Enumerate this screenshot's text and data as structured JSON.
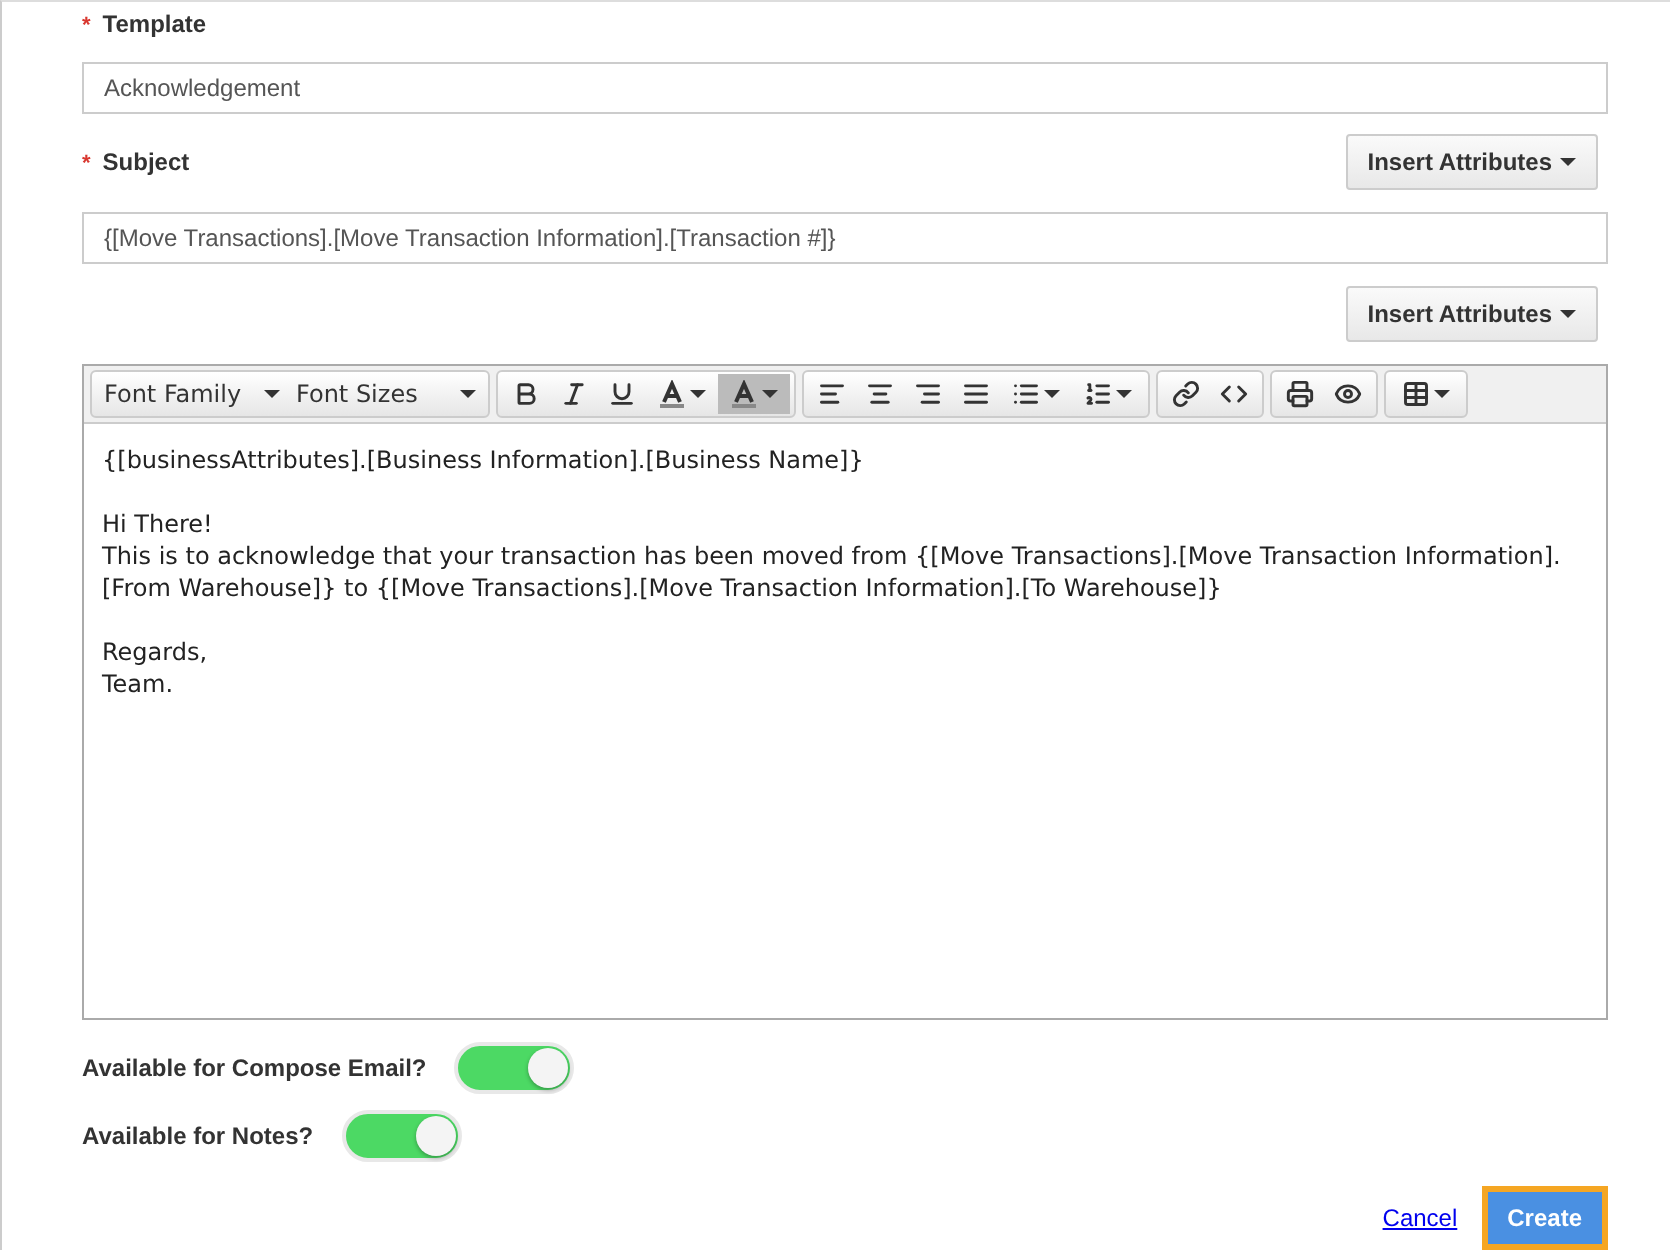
{
  "template": {
    "required_mark": "*",
    "label": "Template",
    "value": "Acknowledgement"
  },
  "subject": {
    "required_mark": "*",
    "label": "Subject",
    "value": "{[Move Transactions].[Move Transaction Information].[Transaction #]}",
    "insert_button": "Insert Attributes"
  },
  "body_insert_button": "Insert Attributes",
  "editor": {
    "selects": [
      "Font Family",
      "Font Sizes"
    ],
    "blocks": [
      [
        "{[businessAttributes].[Business Information].[Business Name]}"
      ],
      [
        "Hi There!",
        "This is to acknowledge that your transaction has been moved from {[Move Transactions].[Move Transaction Information].[From Warehouse]}  to {[Move Transactions].[Move Transaction Information].[To Warehouse]}"
      ],
      [
        "Regards,",
        "Team."
      ]
    ]
  },
  "toggles": [
    {
      "label": "Available for Compose Email?",
      "on": true
    },
    {
      "label": "Available for Notes?",
      "on": true
    }
  ],
  "actions": {
    "cancel": "Cancel",
    "create": "Create"
  }
}
